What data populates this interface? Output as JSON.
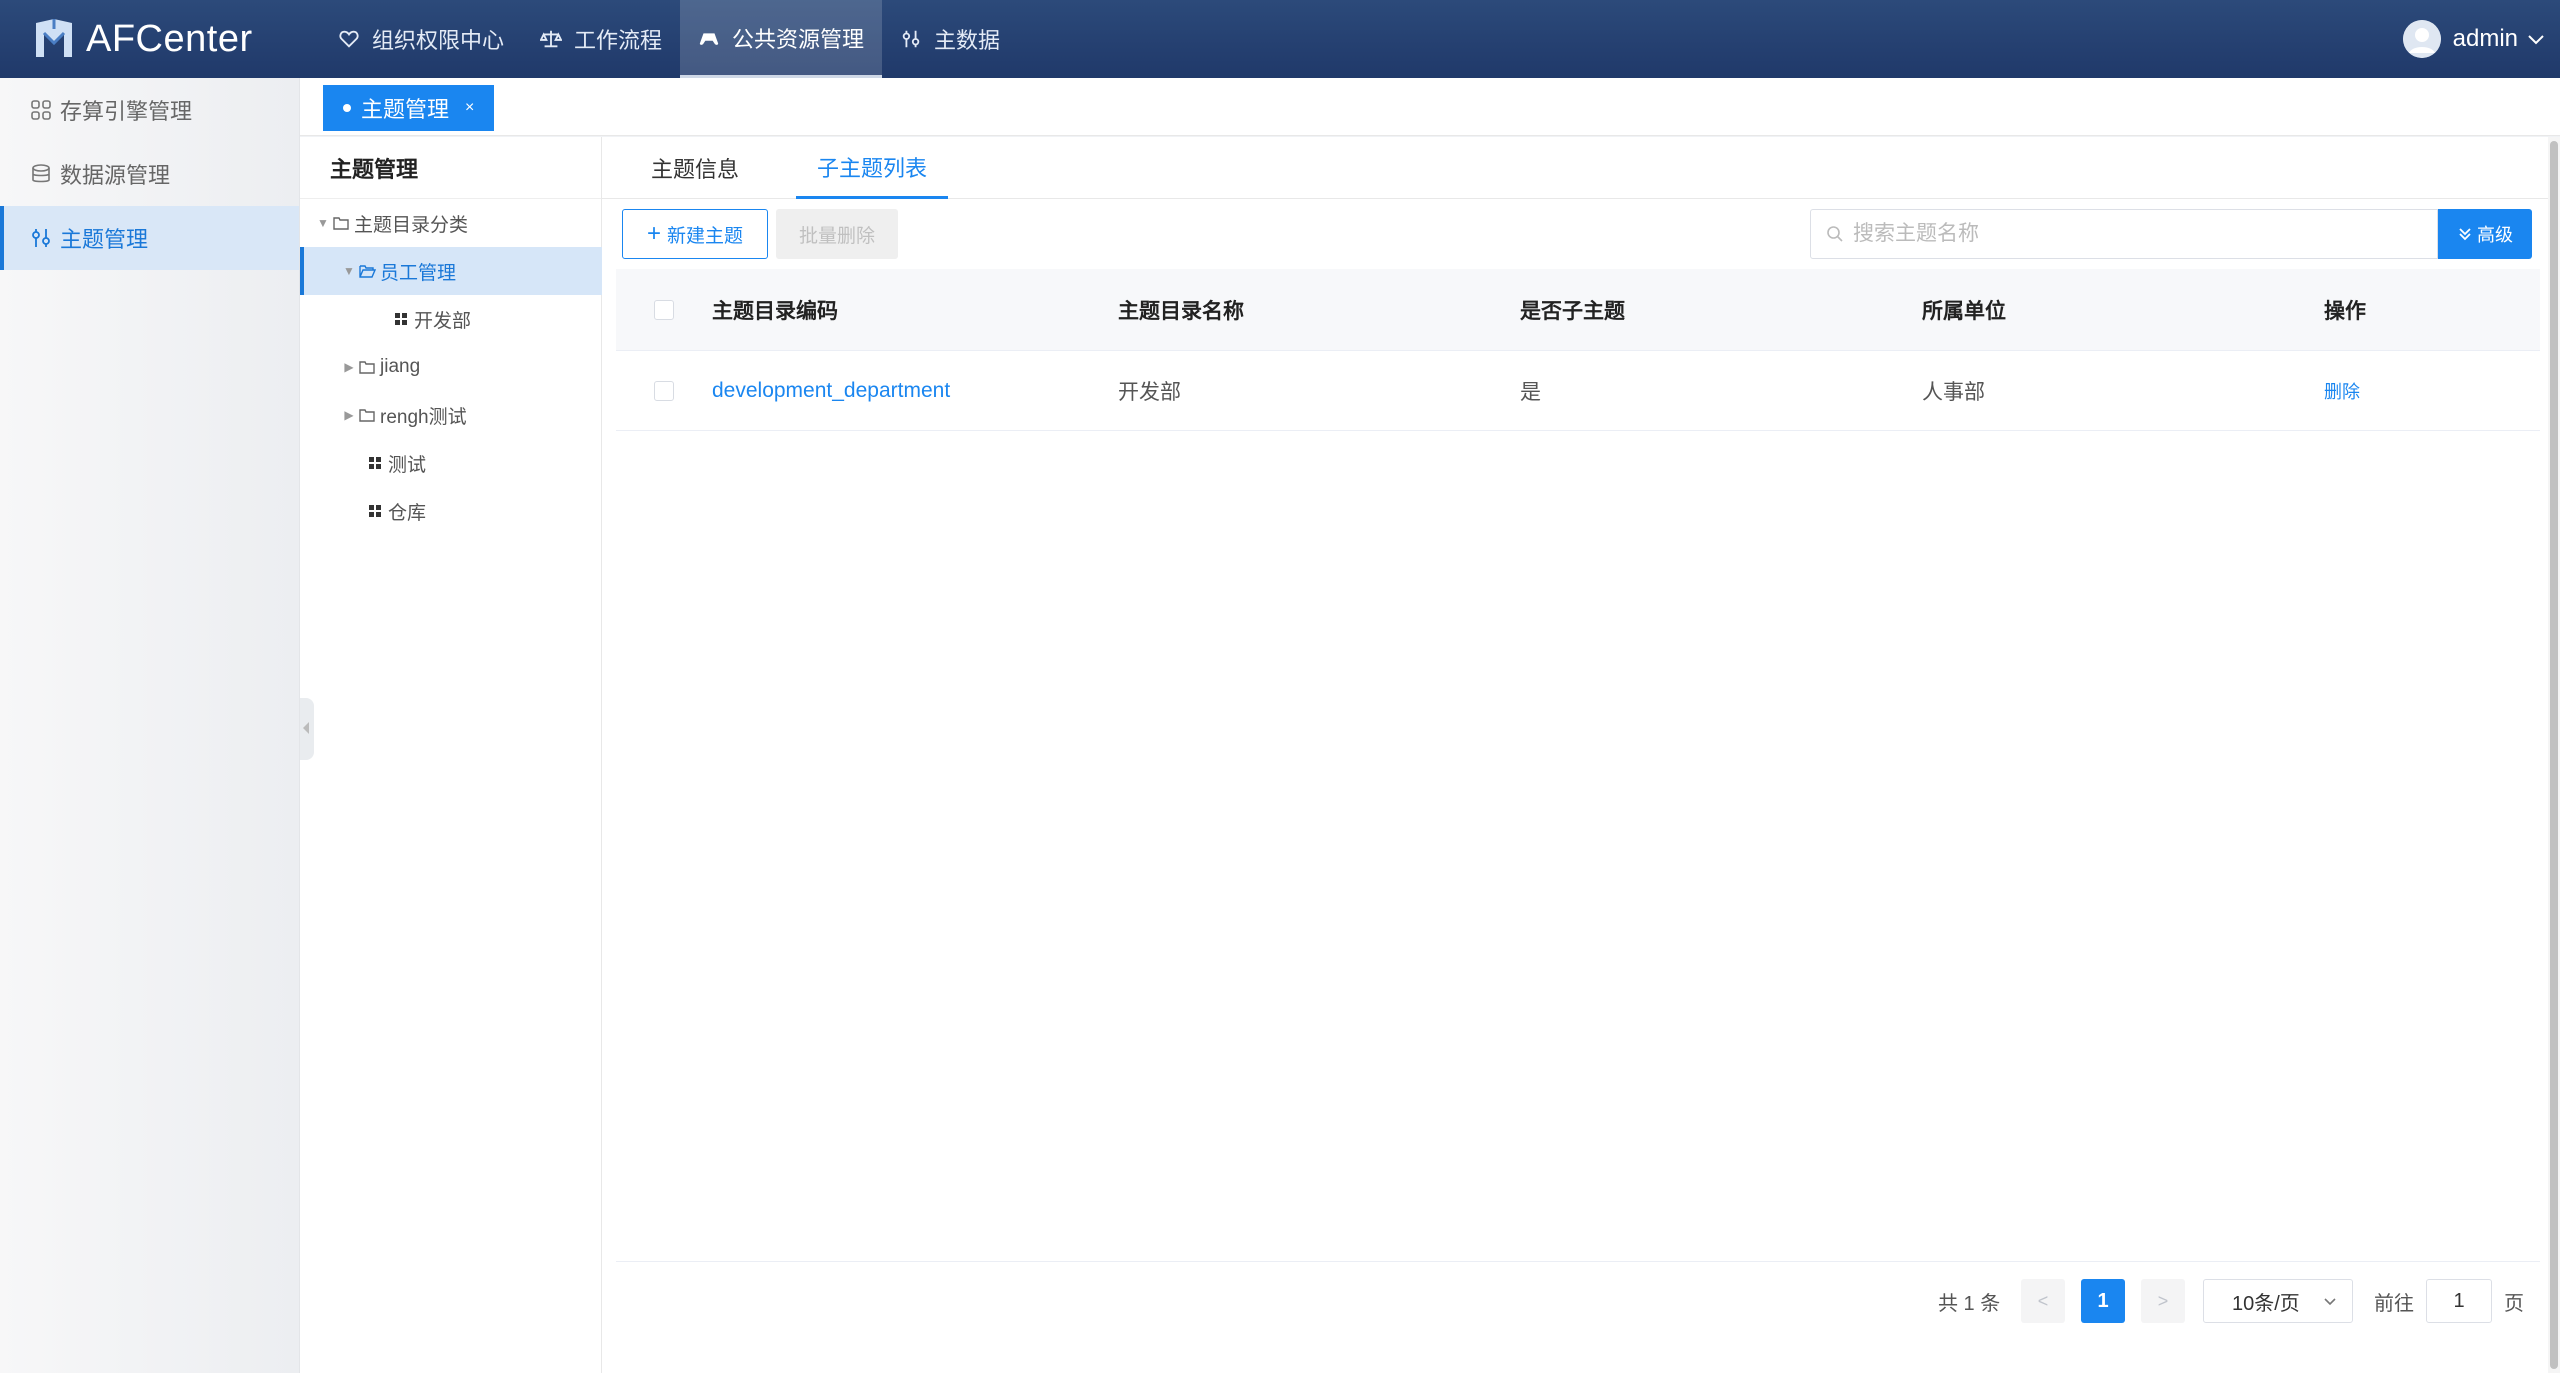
{
  "app": {
    "name": "AFCenter",
    "accent": "#1a86f0",
    "header_bg": "#20396a"
  },
  "topnav": [
    {
      "label": "组织权限中心",
      "icon": "heart-icon"
    },
    {
      "label": "工作流程",
      "icon": "balance-icon"
    },
    {
      "label": "公共资源管理",
      "icon": "controller-icon",
      "active": true
    },
    {
      "label": "主数据",
      "icon": "sliders-icon"
    }
  ],
  "user": {
    "name": "admin"
  },
  "sidebar": {
    "items": [
      {
        "label": "存算引擎管理",
        "icon": "grid-icon"
      },
      {
        "label": "数据源管理",
        "icon": "database-icon"
      },
      {
        "label": "主题管理",
        "icon": "sliders-icon",
        "active": true
      }
    ]
  },
  "page_tabs": [
    {
      "label": "主题管理",
      "close": "×"
    }
  ],
  "tree": {
    "title": "主题管理",
    "nodes": [
      {
        "label": "主题目录分类",
        "level": 0,
        "expanded": true,
        "icon": "folder-icon"
      },
      {
        "label": "员工管理",
        "level": 1,
        "expanded": true,
        "selected": true,
        "icon": "folder-open-icon"
      },
      {
        "label": "开发部",
        "level": 2,
        "icon": "grid-icon"
      },
      {
        "label": "jiang",
        "level": 1,
        "expanded": false,
        "icon": "folder-icon"
      },
      {
        "label": "rengh测试",
        "level": 1,
        "expanded": false,
        "icon": "folder-icon"
      },
      {
        "label": "测试",
        "level": 1,
        "icon": "grid-icon"
      },
      {
        "label": "仓库",
        "level": 1,
        "icon": "grid-icon"
      }
    ]
  },
  "subtabs": [
    {
      "label": "主题信息"
    },
    {
      "label": "子主题列表",
      "active": true
    }
  ],
  "toolbar": {
    "new_label": "新建主题",
    "batch_delete_label": "批量删除",
    "search_placeholder": "搜索主题名称",
    "search_value": "",
    "advanced_label": "高级"
  },
  "table": {
    "headers": [
      "主题目录编码",
      "主题目录名称",
      "是否子主题",
      "所属单位",
      "操作"
    ],
    "rows": [
      {
        "code": "development_department",
        "name": "开发部",
        "is_sub": "是",
        "unit": "人事部",
        "action": "删除"
      }
    ]
  },
  "pagination": {
    "total_text": "共 1 条",
    "prev": "<",
    "next": ">",
    "current_page": "1",
    "page_size": "10条/页",
    "goto_prefix": "前往",
    "goto_value": "1",
    "goto_suffix": "页"
  }
}
